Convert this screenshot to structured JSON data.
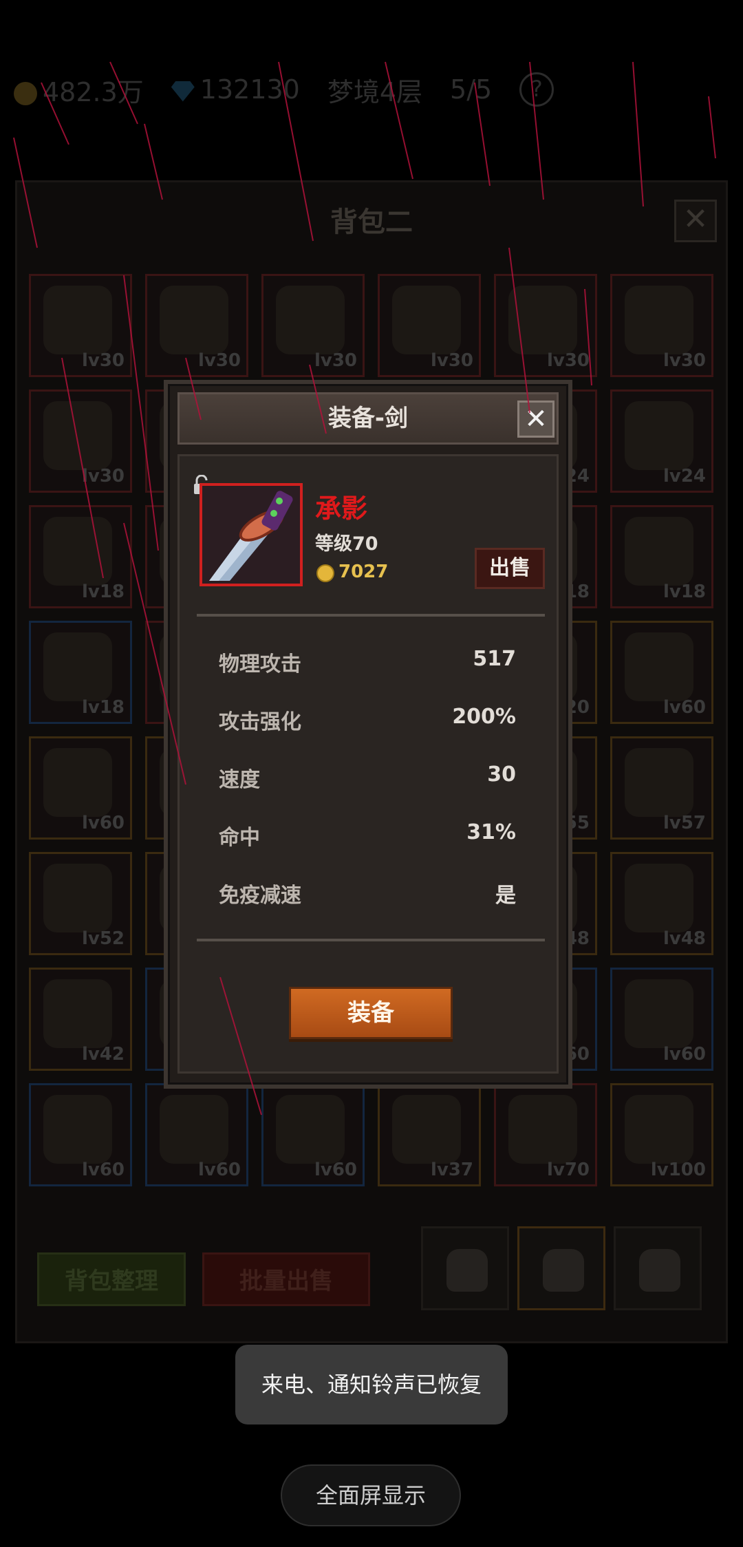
{
  "hud": {
    "gold": "482.3万",
    "gems": "132130",
    "stage": "梦境4层",
    "skulls": "5/5",
    "help": "?"
  },
  "bag": {
    "title": "背包二",
    "close": "✕",
    "slots": [
      {
        "lv": "lv30",
        "q": "q1"
      },
      {
        "lv": "lv30",
        "q": "q1"
      },
      {
        "lv": "lv30",
        "q": "q1"
      },
      {
        "lv": "lv30",
        "q": "q1"
      },
      {
        "lv": "lv30",
        "q": "q1"
      },
      {
        "lv": "lv30",
        "q": "q1"
      },
      {
        "lv": "lv30",
        "q": "q1"
      },
      {
        "lv": "",
        "q": "q1"
      },
      {
        "lv": "",
        "q": "q1"
      },
      {
        "lv": "",
        "q": "q1"
      },
      {
        "lv": "lv24",
        "q": "q1"
      },
      {
        "lv": "lv24",
        "q": "q1"
      },
      {
        "lv": "lv18",
        "q": "q1"
      },
      {
        "lv": "",
        "q": "q1"
      },
      {
        "lv": "",
        "q": "q1"
      },
      {
        "lv": "",
        "q": "q1"
      },
      {
        "lv": "lv18",
        "q": "q1"
      },
      {
        "lv": "lv18",
        "q": "q1"
      },
      {
        "lv": "lv18",
        "q": "q3"
      },
      {
        "lv": "",
        "q": "q1"
      },
      {
        "lv": "",
        "q": "q1"
      },
      {
        "lv": "",
        "q": "q1"
      },
      {
        "lv": "lv20",
        "q": "q2"
      },
      {
        "lv": "lv60",
        "q": "q2"
      },
      {
        "lv": "lv60",
        "q": "q2"
      },
      {
        "lv": "",
        "q": "q2"
      },
      {
        "lv": "",
        "q": "q2"
      },
      {
        "lv": "",
        "q": "q2"
      },
      {
        "lv": "lv55",
        "q": "q2"
      },
      {
        "lv": "lv57",
        "q": "q2"
      },
      {
        "lv": "lv52",
        "q": "q2"
      },
      {
        "lv": "",
        "q": "q2"
      },
      {
        "lv": "",
        "q": "q2"
      },
      {
        "lv": "",
        "q": "q2"
      },
      {
        "lv": "lv48",
        "q": "q2"
      },
      {
        "lv": "lv48",
        "q": "q2"
      },
      {
        "lv": "lv42",
        "q": "q2"
      },
      {
        "lv": "",
        "q": "q3"
      },
      {
        "lv": "",
        "q": "q3"
      },
      {
        "lv": "",
        "q": "q3"
      },
      {
        "lv": "lv60",
        "q": "q3"
      },
      {
        "lv": "lv60",
        "q": "q3"
      },
      {
        "lv": "lv60",
        "q": "q3"
      },
      {
        "lv": "lv60",
        "q": "q3"
      },
      {
        "lv": "lv60",
        "q": "q3"
      },
      {
        "lv": "lv37",
        "q": "q2"
      },
      {
        "lv": "lv70",
        "q": "q1"
      },
      {
        "lv": "lv100",
        "q": "q2"
      }
    ],
    "sort_label": "背包整理",
    "bulk_sell_label": "批量出售"
  },
  "modal": {
    "title": "装备-剑",
    "close": "✕",
    "item": {
      "name": "承影",
      "level": "等级70",
      "price": "7027"
    },
    "sell_label": "出售",
    "stats": [
      {
        "label": "物理攻击",
        "value": "517"
      },
      {
        "label": "攻击强化",
        "value": "200%"
      },
      {
        "label": "速度",
        "value": "30"
      },
      {
        "label": "命中",
        "value": "31%"
      },
      {
        "label": "免疫减速",
        "value": "是"
      }
    ],
    "equip_label": "装备"
  },
  "system": {
    "toast": "来电、通知铃声已恢复",
    "fullscreen": "全面屏显示"
  },
  "colors": {
    "rarity_red": "#d0201f",
    "price_gold": "#e7c14f",
    "equip_orange": "#c05c1b"
  }
}
